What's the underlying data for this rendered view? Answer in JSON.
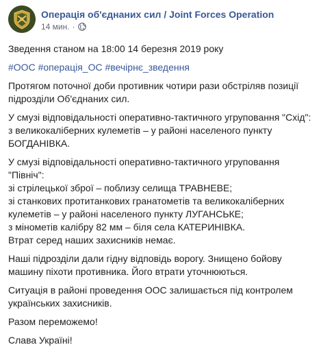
{
  "page": {
    "name": "Операція об'єднаних сил / Joint Forces Operation",
    "time": "14 мин.",
    "dot": "·",
    "accent": "#385898",
    "avatar_color": "#3d4a22"
  },
  "post": {
    "headline": "Зведення станом на 18:00 14 березня 2019 року",
    "hashtags": [
      "#ООС",
      "#операція_ОС",
      "#вечірнє_зведення"
    ],
    "p1": [
      "Протягом поточної доби противник чотири рази обстріляв позиції",
      "підрозділи Об'єднаних сил."
    ],
    "p2": [
      "У смузі відповідальності оперативно-тактичного угруповання \"Схід\":",
      "з великокаліберних кулеметів – у районі населеного пункту",
      "БОГДАНІВКА."
    ],
    "p3": [
      "У смузі відповідальності оперативно-тактичного угруповання",
      "\"Північ\":",
      "зі стрілецької зброї – поблизу селища ТРАВНЕВЕ;",
      "зі станкових протитанкових гранатометів та великокаліберних",
      "кулеметів – у районі населеного пункту ЛУГАНСЬКЕ;",
      "з мінометів калібру 82 мм – біля села КАТЕРИНІВКА.",
      "Втрат серед наших захисників немає."
    ],
    "p4": [
      "Наші підрозділи дали гідну відповідь ворогу. Знищено бойову",
      "машину піхоти противника. Його втрати уточнюються."
    ],
    "p5": [
      "Ситуація в районі проведення ООС залишається під контролем",
      "українських захисників."
    ],
    "p6": "Разом переможемо!",
    "p7": "Слава Україні!"
  }
}
